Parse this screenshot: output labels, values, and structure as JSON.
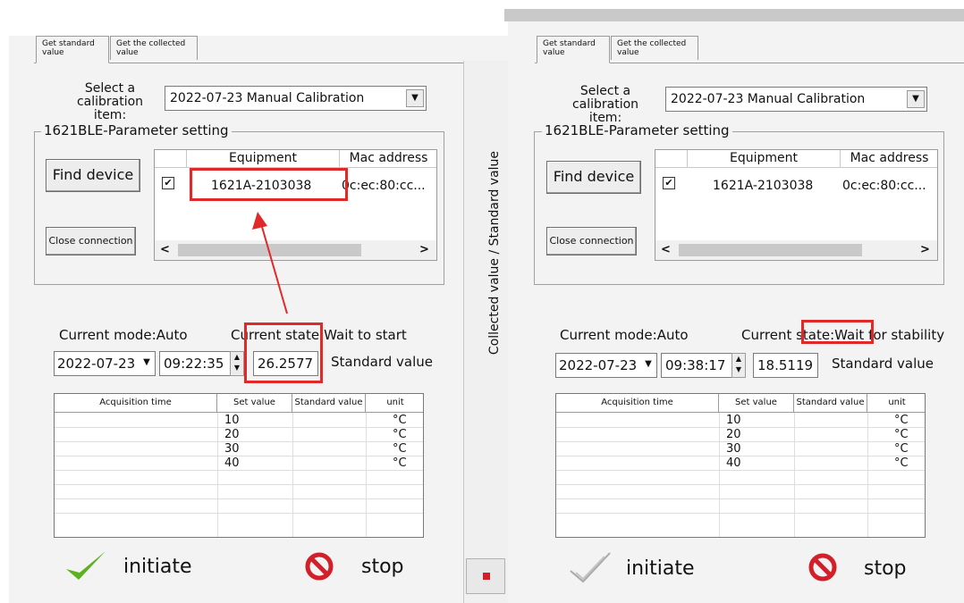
{
  "tabs": {
    "standard": "Get standard value",
    "collected": "Get the collected value"
  },
  "calibration": {
    "label": "Select a calibration item:",
    "selected": "2022-07-23  Manual Calibration"
  },
  "group_title": "1621BLE-Parameter setting",
  "buttons": {
    "find": "Find device",
    "close": "Close connection",
    "initiate": "initiate",
    "stop": "stop"
  },
  "device_list": {
    "columns": [
      "Equipment",
      "Mac address"
    ],
    "rows": [
      {
        "checked": true,
        "equipment": "1621A-2103038",
        "mac": "0c:ec:80:cc..."
      }
    ]
  },
  "vertical_label": "Collected value / Standard value",
  "standard_value_label": "Standard value",
  "left": {
    "mode": "Current mode:Auto",
    "state": "Current state:Wait to start",
    "date": "2022-07-23",
    "time": "09:22:35",
    "value": "26.2577"
  },
  "right": {
    "mode": "Current mode:Auto",
    "state": "Current state:Wait for stability",
    "date": "2022-07-23",
    "time": "09:38:17",
    "value": "18.5119"
  },
  "table": {
    "columns": [
      "Acquisition time",
      "Set value",
      "Standard value",
      "unit"
    ],
    "rows": [
      {
        "time": "",
        "set": "10",
        "standard": "",
        "unit": "°C"
      },
      {
        "time": "",
        "set": "20",
        "standard": "",
        "unit": "°C"
      },
      {
        "time": "",
        "set": "30",
        "standard": "",
        "unit": "°C"
      },
      {
        "time": "",
        "set": "40",
        "standard": "",
        "unit": "°C"
      }
    ]
  },
  "icons": {
    "scroll_left": "<",
    "scroll_right": ">",
    "dropdown": "▼",
    "spin_up": "▲",
    "spin_down": "▼"
  },
  "colors": {
    "highlight": "#e02a2a",
    "check_green": "#5bb21e",
    "stop_red": "#d2202a"
  }
}
